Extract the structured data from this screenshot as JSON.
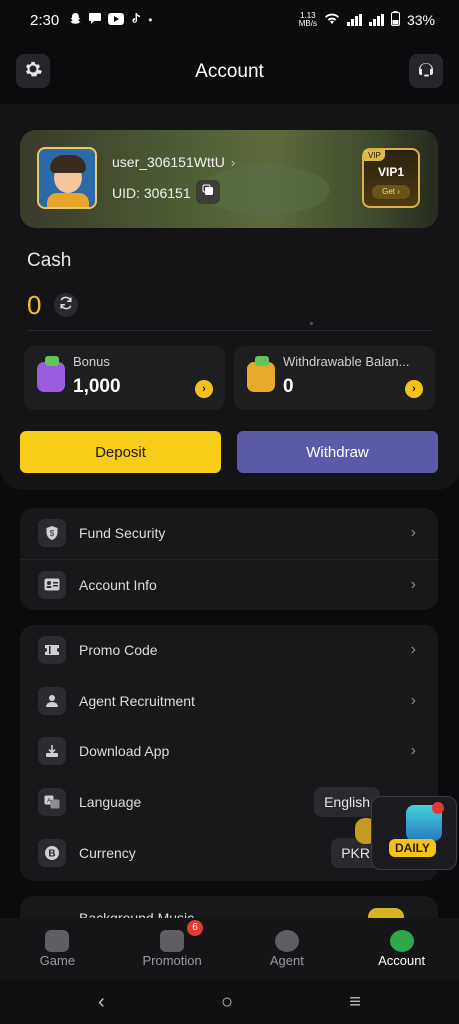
{
  "status_bar": {
    "time": "2:30",
    "network_speed_value": "1.13",
    "network_speed_unit": "MB/s",
    "battery": "33%",
    "icons": [
      "snapchat-icon",
      "chat-icon",
      "youtube-icon",
      "tiktok-icon",
      "dot-icon",
      "wifi-icon",
      "signal-icon",
      "signal-icon",
      "battery-icon"
    ]
  },
  "header": {
    "title": "Account",
    "left_icon": "gear-icon",
    "right_icon": "support-headset-icon"
  },
  "profile": {
    "username": "user_306151WttU",
    "uid_label": "UID: 306151",
    "vip_tag": "VIP",
    "vip_level": "VIP1",
    "vip_action": "Get ›"
  },
  "cash": {
    "label": "Cash",
    "value": "0"
  },
  "balances": [
    {
      "label": "Bonus",
      "value": "1,000"
    },
    {
      "label": "Withdrawable Balan...",
      "value": "0"
    }
  ],
  "actions": {
    "deposit": "Deposit",
    "withdraw": "Withdraw"
  },
  "menu_group_1": [
    {
      "label": "Fund Security",
      "icon": "shield-icon"
    },
    {
      "label": "Account Info",
      "icon": "id-card-icon"
    }
  ],
  "menu_group_2": [
    {
      "label": "Promo Code",
      "icon": "ticket-icon"
    },
    {
      "label": "Agent Recruitment",
      "icon": "user-icon"
    },
    {
      "label": "Download App",
      "icon": "download-icon"
    },
    {
      "label": "Language",
      "icon": "translate-icon",
      "value": "English"
    },
    {
      "label": "Currency",
      "icon": "bitcoin-icon",
      "value": "PKR"
    }
  ],
  "partial_row": {
    "label": "Background Music"
  },
  "daily": {
    "label": "DAILY"
  },
  "tabbar": [
    {
      "label": "Game",
      "icon": "gamepad-icon",
      "active": false,
      "badge": ""
    },
    {
      "label": "Promotion",
      "icon": "gift-box-icon",
      "active": false,
      "badge": "6"
    },
    {
      "label": "Agent",
      "icon": "coin-stack-icon",
      "active": false,
      "badge": ""
    },
    {
      "label": "Account",
      "icon": "user-circle-icon",
      "active": true,
      "badge": ""
    }
  ],
  "system_nav": {
    "back": "‹",
    "home": "○",
    "recents": "≡"
  },
  "colors": {
    "accent_yellow": "#f7cd1a",
    "withdraw_purple": "#5b5aa8",
    "active_green": "#2ea84a",
    "badge_red": "#e53935"
  }
}
